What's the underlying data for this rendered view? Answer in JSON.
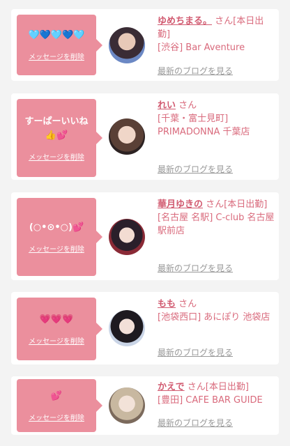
{
  "delete_label": "メッセージを削除",
  "blog_label": "最新のブログを見る",
  "honorific": "さん",
  "cards": [
    {
      "message": "🩵💙🩵💙🩵",
      "name": "ゆめちまる。",
      "suffix": "[本日出勤]",
      "shop": "[渋谷] Bar Aventure",
      "avatar_icon": "girl-avatar"
    },
    {
      "message": "すーぱーいいね👍💕",
      "name": "れい",
      "suffix": "",
      "shop": "[千葉・富士見町] PRIMADONNA 千葉店",
      "avatar_icon": "girl-avatar"
    },
    {
      "message": "(○•⊙•○)💕",
      "name": "華月ゆきの",
      "suffix": "[本日出勤]",
      "shop": "[名古屋 名駅] C-club 名古屋駅前店",
      "avatar_icon": "girl-avatar"
    },
    {
      "message": "💗💗💗",
      "name": "もも",
      "suffix": "",
      "shop": "[池袋西口] あにぽり 池袋店",
      "avatar_icon": "girl-avatar"
    },
    {
      "message": "💕",
      "name": "かえで",
      "suffix": "[本日出勤]",
      "shop": "[豊田] CAFE BAR GUIDE",
      "avatar_icon": "girl-avatar"
    }
  ],
  "colors": {
    "bubble": "#eb8f9d",
    "name": "#d15a70",
    "text": "#d96a7c",
    "link": "#999999"
  }
}
